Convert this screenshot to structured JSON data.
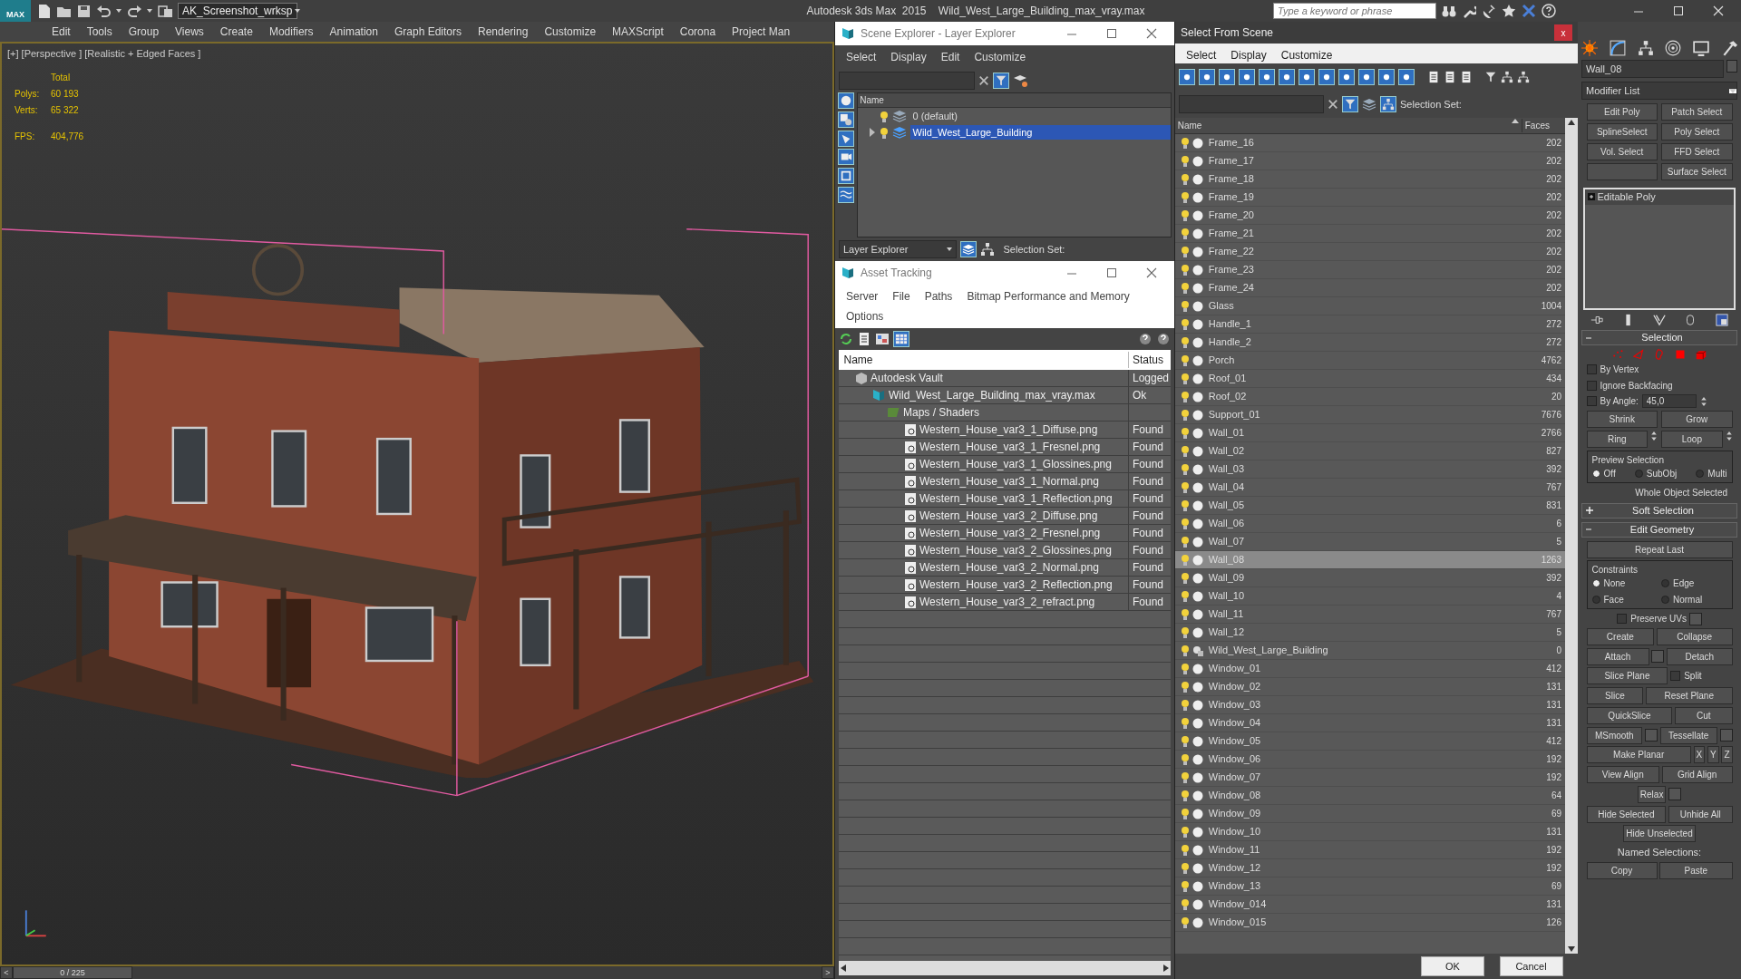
{
  "app": {
    "logo": "MAX",
    "workspace": "AK_Screenshot_wrksp",
    "title": "Autodesk 3ds Max  2015    Wild_West_Large_Building_max_vray.max",
    "search_placeholder": "Type a keyword or phrase"
  },
  "menu": [
    "Edit",
    "Tools",
    "Group",
    "Views",
    "Create",
    "Modifiers",
    "Animation",
    "Graph Editors",
    "Rendering",
    "Customize",
    "MAXScript",
    "Corona",
    "Project Man"
  ],
  "viewport": {
    "label": "[+] [Perspective ] [Realistic + Edged Faces ]",
    "stats_header": "Total",
    "stats": [
      {
        "label": "Polys:",
        "value": "60 193"
      },
      {
        "label": "Verts:",
        "value": "65 322"
      }
    ],
    "fps_label": "FPS:",
    "fps": "404,776"
  },
  "timeline": {
    "prev": "<",
    "frame": "0 / 225",
    "next": ">"
  },
  "scene_explorer": {
    "title": "Scene Explorer - Layer Explorer",
    "menu": [
      "Select",
      "Display",
      "Edit",
      "Customize"
    ],
    "column": "Name",
    "layers": [
      {
        "name": "0 (default)",
        "selected": false,
        "expandable": false
      },
      {
        "name": "Wild_West_Large_Building",
        "selected": true,
        "expandable": true
      }
    ],
    "explorer": "Layer Explorer",
    "selection_set": "Selection Set:"
  },
  "asset_tracking": {
    "title": "Asset Tracking",
    "menu": [
      "Server",
      "File",
      "Paths",
      "Bitmap Performance and Memory",
      "Options"
    ],
    "columns": [
      "Name",
      "Status"
    ],
    "tree": [
      {
        "name": "Autodesk Vault",
        "status": "Logged",
        "kind": "vault",
        "children": [
          {
            "name": "Wild_West_Large_Building_max_vray.max",
            "status": "Ok",
            "kind": "scene",
            "children": [
              {
                "name": "Maps / Shaders",
                "kind": "folder",
                "children": [
                  {
                    "name": "Western_House_var3_1_Diffuse.png",
                    "status": "Found",
                    "kind": "bitmap"
                  },
                  {
                    "name": "Western_House_var3_1_Fresnel.png",
                    "status": "Found",
                    "kind": "bitmap"
                  },
                  {
                    "name": "Western_House_var3_1_Glossines.png",
                    "status": "Found",
                    "kind": "bitmap"
                  },
                  {
                    "name": "Western_House_var3_1_Normal.png",
                    "status": "Found",
                    "kind": "bitmap"
                  },
                  {
                    "name": "Western_House_var3_1_Reflection.png",
                    "status": "Found",
                    "kind": "bitmap"
                  },
                  {
                    "name": "Western_House_var3_2_Diffuse.png",
                    "status": "Found",
                    "kind": "bitmap"
                  },
                  {
                    "name": "Western_House_var3_2_Fresnel.png",
                    "status": "Found",
                    "kind": "bitmap"
                  },
                  {
                    "name": "Western_House_var3_2_Glossines.png",
                    "status": "Found",
                    "kind": "bitmap"
                  },
                  {
                    "name": "Western_House_var3_2_Normal.png",
                    "status": "Found",
                    "kind": "bitmap"
                  },
                  {
                    "name": "Western_House_var3_2_Reflection.png",
                    "status": "Found",
                    "kind": "bitmap"
                  },
                  {
                    "name": "Western_House_var3_2_refract.png",
                    "status": "Found",
                    "kind": "bitmap"
                  }
                ]
              }
            ]
          }
        ]
      }
    ]
  },
  "select_from_scene": {
    "title": "Select From Scene",
    "close": "x",
    "menu": [
      "Select",
      "Display",
      "Customize"
    ],
    "selection_set": "Selection Set:",
    "columns": [
      "Name",
      "Faces"
    ],
    "rows": [
      {
        "name": "Frame_16",
        "faces": "202",
        "selected": false,
        "kind": "object"
      },
      {
        "name": "Frame_17",
        "faces": "202",
        "selected": false,
        "kind": "object"
      },
      {
        "name": "Frame_18",
        "faces": "202",
        "selected": false,
        "kind": "object"
      },
      {
        "name": "Frame_19",
        "faces": "202",
        "selected": false,
        "kind": "object"
      },
      {
        "name": "Frame_20",
        "faces": "202",
        "selected": false,
        "kind": "object"
      },
      {
        "name": "Frame_21",
        "faces": "202",
        "selected": false,
        "kind": "object"
      },
      {
        "name": "Frame_22",
        "faces": "202",
        "selected": false,
        "kind": "object"
      },
      {
        "name": "Frame_23",
        "faces": "202",
        "selected": false,
        "kind": "object"
      },
      {
        "name": "Frame_24",
        "faces": "202",
        "selected": false,
        "kind": "object"
      },
      {
        "name": "Glass",
        "faces": "1004",
        "selected": false,
        "kind": "object"
      },
      {
        "name": "Handle_1",
        "faces": "272",
        "selected": false,
        "kind": "object"
      },
      {
        "name": "Handle_2",
        "faces": "272",
        "selected": false,
        "kind": "object"
      },
      {
        "name": "Porch",
        "faces": "4762",
        "selected": false,
        "kind": "object"
      },
      {
        "name": "Roof_01",
        "faces": "434",
        "selected": false,
        "kind": "object"
      },
      {
        "name": "Roof_02",
        "faces": "20",
        "selected": false,
        "kind": "object"
      },
      {
        "name": "Support_01",
        "faces": "7676",
        "selected": false,
        "kind": "object"
      },
      {
        "name": "Wall_01",
        "faces": "2766",
        "selected": false,
        "kind": "object"
      },
      {
        "name": "Wall_02",
        "faces": "827",
        "selected": false,
        "kind": "object"
      },
      {
        "name": "Wall_03",
        "faces": "392",
        "selected": false,
        "kind": "object"
      },
      {
        "name": "Wall_04",
        "faces": "767",
        "selected": false,
        "kind": "object"
      },
      {
        "name": "Wall_05",
        "faces": "831",
        "selected": false,
        "kind": "object"
      },
      {
        "name": "Wall_06",
        "faces": "6",
        "selected": false,
        "kind": "object"
      },
      {
        "name": "Wall_07",
        "faces": "5",
        "selected": false,
        "kind": "object"
      },
      {
        "name": "Wall_08",
        "faces": "1263",
        "selected": true,
        "kind": "object"
      },
      {
        "name": "Wall_09",
        "faces": "392",
        "selected": false,
        "kind": "object"
      },
      {
        "name": "Wall_10",
        "faces": "4",
        "selected": false,
        "kind": "object"
      },
      {
        "name": "Wall_11",
        "faces": "767",
        "selected": false,
        "kind": "object"
      },
      {
        "name": "Wall_12",
        "faces": "5",
        "selected": false,
        "kind": "object"
      },
      {
        "name": "Wild_West_Large_Building",
        "faces": "0",
        "selected": false,
        "kind": "group"
      },
      {
        "name": "Window_01",
        "faces": "412",
        "selected": false,
        "kind": "object"
      },
      {
        "name": "Window_02",
        "faces": "131",
        "selected": false,
        "kind": "object"
      },
      {
        "name": "Window_03",
        "faces": "131",
        "selected": false,
        "kind": "object"
      },
      {
        "name": "Window_04",
        "faces": "131",
        "selected": false,
        "kind": "object"
      },
      {
        "name": "Window_05",
        "faces": "412",
        "selected": false,
        "kind": "object"
      },
      {
        "name": "Window_06",
        "faces": "192",
        "selected": false,
        "kind": "object"
      },
      {
        "name": "Window_07",
        "faces": "192",
        "selected": false,
        "kind": "object"
      },
      {
        "name": "Window_08",
        "faces": "64",
        "selected": false,
        "kind": "object"
      },
      {
        "name": "Window_09",
        "faces": "69",
        "selected": false,
        "kind": "object"
      },
      {
        "name": "Window_10",
        "faces": "131",
        "selected": false,
        "kind": "object"
      },
      {
        "name": "Window_11",
        "faces": "192",
        "selected": false,
        "kind": "object"
      },
      {
        "name": "Window_12",
        "faces": "192",
        "selected": false,
        "kind": "object"
      },
      {
        "name": "Window_13",
        "faces": "69",
        "selected": false,
        "kind": "object"
      },
      {
        "name": "Window_014",
        "faces": "131",
        "selected": false,
        "kind": "object"
      },
      {
        "name": "Window_015",
        "faces": "126",
        "selected": false,
        "kind": "object"
      }
    ],
    "buttons": [
      "OK",
      "Cancel"
    ]
  },
  "command_panel": {
    "object_name": "Wall_08",
    "modifier_list": "Modifier List",
    "modifier_buttons": [
      "Edit Poly",
      "Patch Select",
      "SplineSelect",
      "Poly Select",
      "Vol. Select",
      "FFD Select",
      "Surface Select"
    ],
    "stack": [
      "Editable Poly"
    ],
    "rollouts": [
      {
        "title": "Selection",
        "expanded": true,
        "kind": "selection",
        "options": [
          {
            "label": "By Vertex",
            "checked": false
          },
          {
            "label": "Ignore Backfacing",
            "checked": false
          },
          {
            "label": "By Angle:",
            "checked": false,
            "value": "45,0"
          }
        ],
        "buttons": [
          {
            "label": "Shrink",
            "spinner": false
          },
          {
            "label": "Grow",
            "spinner": false
          },
          {
            "label": "Ring",
            "spinner": true
          },
          {
            "label": "Loop",
            "spinner": true
          }
        ],
        "preview_title": "Preview Selection",
        "preview": [
          {
            "label": "Off",
            "selected": true
          },
          {
            "label": "SubObj",
            "selected": false
          },
          {
            "label": "Multi",
            "selected": false
          }
        ],
        "status": "Whole Object Selected"
      },
      {
        "title": "Soft Selection",
        "expanded": false
      },
      {
        "title": "Edit Geometry",
        "expanded": true,
        "kind": "geometry",
        "repeat": "Repeat Last",
        "constraints_title": "Constraints",
        "constraints": [
          {
            "label": "None",
            "selected": true
          },
          {
            "label": "Edge",
            "selected": false
          },
          {
            "label": "Face",
            "selected": false
          },
          {
            "label": "Normal",
            "selected": false
          }
        ],
        "rows": [
          [
            {
              "kind": "check",
              "label": "Preserve UVs",
              "checked": false,
              "settings": true
            }
          ],
          [
            {
              "kind": "button",
              "label": "Create"
            },
            {
              "kind": "button",
              "label": "Collapse"
            }
          ],
          [
            {
              "kind": "button",
              "label": "Attach",
              "settings": true
            },
            {
              "kind": "button",
              "label": "Detach"
            }
          ],
          [
            {
              "kind": "button",
              "label": "Slice Plane"
            },
            {
              "kind": "check",
              "label": "Split",
              "checked": false
            }
          ],
          [
            {
              "kind": "button",
              "label": "Slice"
            },
            {
              "kind": "button",
              "label": "Reset Plane"
            }
          ],
          [
            {
              "kind": "button",
              "label": "QuickSlice"
            },
            {
              "kind": "button",
              "label": "Cut"
            }
          ],
          [
            {
              "kind": "button",
              "label": "MSmooth",
              "settings": true
            },
            {
              "kind": "button",
              "label": "Tessellate",
              "settings": true
            }
          ],
          [
            {
              "kind": "button",
              "label": "Make Planar"
            },
            {
              "kind": "axis",
              "label": "X"
            },
            {
              "kind": "axis",
              "label": "Y"
            },
            {
              "kind": "axis",
              "label": "Z"
            }
          ],
          [
            {
              "kind": "button",
              "label": "View Align"
            },
            {
              "kind": "button",
              "label": "Grid Align"
            }
          ],
          [
            {
              "kind": "button",
              "label": "Relax",
              "settings": true
            }
          ],
          [
            {
              "kind": "button",
              "label": "Hide Selected"
            },
            {
              "kind": "button",
              "label": "Unhide All"
            }
          ],
          [
            {
              "kind": "button",
              "label": "Hide Unselected"
            }
          ],
          [
            {
              "kind": "text",
              "label": "Named Selections:"
            }
          ],
          [
            {
              "kind": "button",
              "label": "Copy"
            },
            {
              "kind": "button",
              "label": "Paste"
            }
          ]
        ]
      }
    ]
  }
}
